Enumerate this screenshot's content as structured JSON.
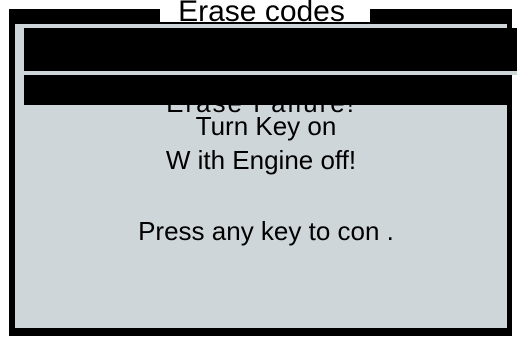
{
  "screen": {
    "title": "Erase codes",
    "partial_line": "Erase Failure!",
    "message_line_1": "Turn Key on",
    "message_line_2": "W ith Engine off!",
    "prompt": "Press any key to con ."
  },
  "colors": {
    "lcd_background": "#cfd6da",
    "frame": "#000000",
    "text": "#000000"
  }
}
